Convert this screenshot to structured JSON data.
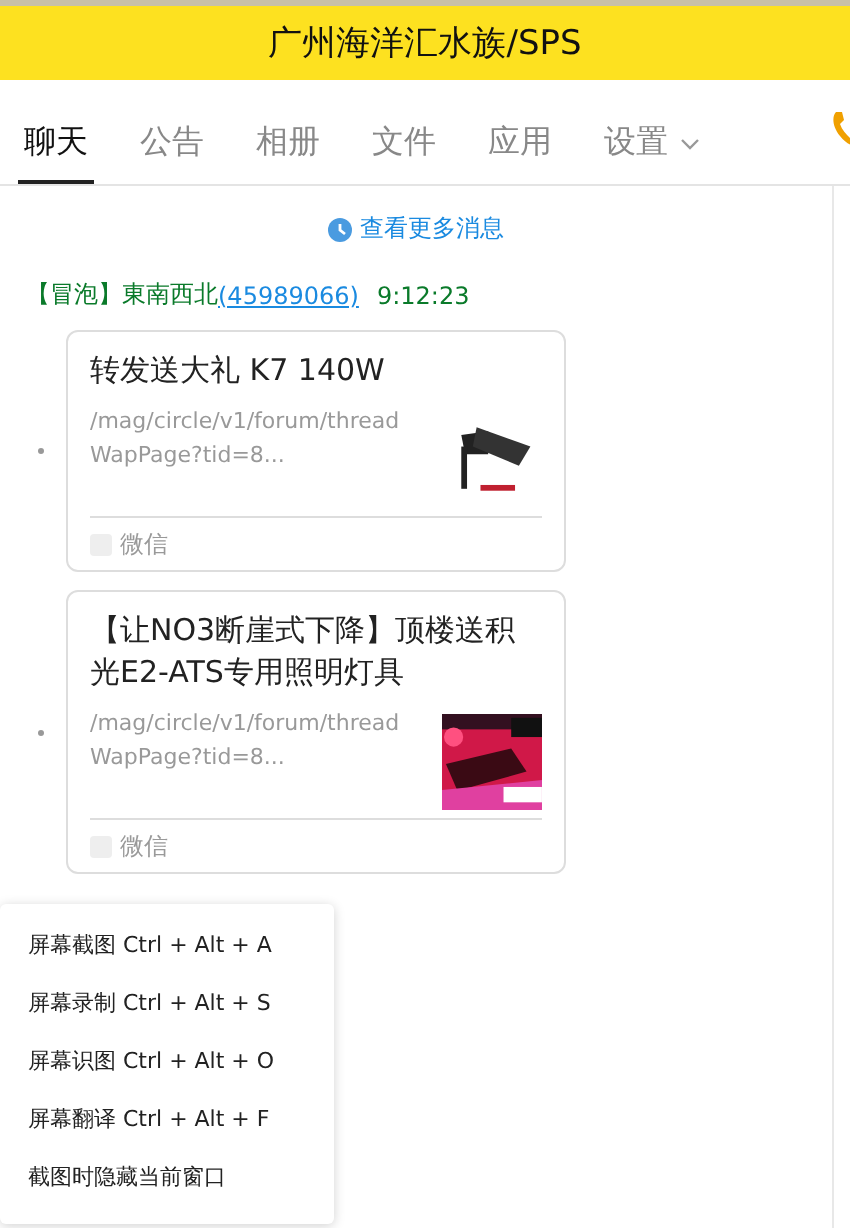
{
  "header": {
    "title": "广州海洋汇水族/SPS"
  },
  "tabs": [
    {
      "label": "聊天",
      "selected": true,
      "has_menu": false
    },
    {
      "label": "公告",
      "selected": false,
      "has_menu": false
    },
    {
      "label": "相册",
      "selected": false,
      "has_menu": false
    },
    {
      "label": "文件",
      "selected": false,
      "has_menu": false
    },
    {
      "label": "应用",
      "selected": false,
      "has_menu": false
    },
    {
      "label": "设置",
      "selected": false,
      "has_menu": true
    }
  ],
  "history_link": "查看更多消息",
  "message": {
    "badge": "【冒泡】",
    "sender": "東南西北",
    "qq": "(45989066)",
    "time": "9:12:23",
    "cards": [
      {
        "title": "转发送大礼 K7 140W",
        "url": "/mag/circle/v1/forum/threadWapPage?tid=8...",
        "source": "微信"
      },
      {
        "title": "【让NO3断崖式下降】顶楼送积光E2-ATS专用照明灯具",
        "url": "/mag/circle/v1/forum/threadWapPage?tid=8...",
        "source": "微信"
      }
    ]
  },
  "context_menu": [
    "屏幕截图 Ctrl + Alt + A",
    "屏幕录制 Ctrl + Alt + S",
    "屏幕识图 Ctrl + Alt + O",
    "屏幕翻译 Ctrl + Alt + F",
    "截图时隐藏当前窗口"
  ]
}
